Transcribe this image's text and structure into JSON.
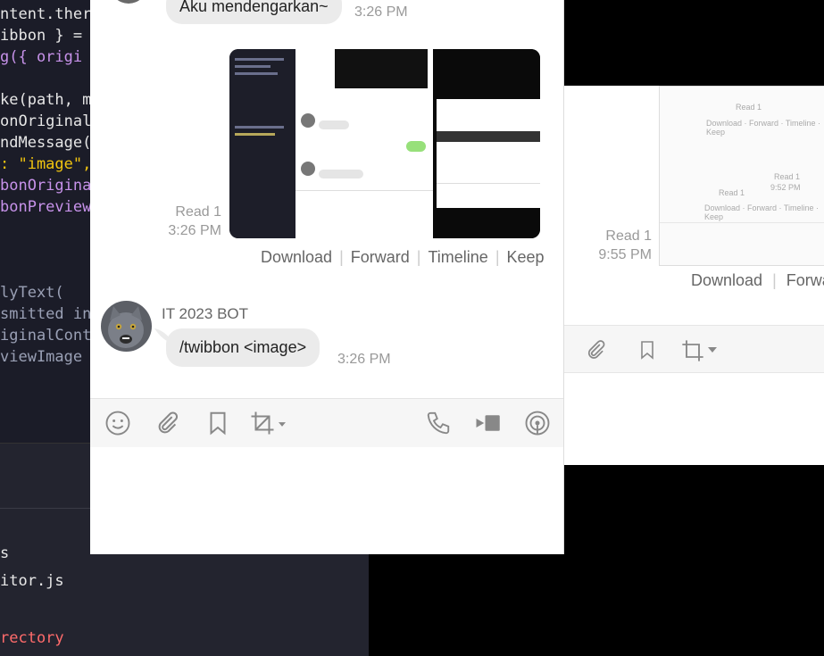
{
  "editor": {
    "code_lines": [
      {
        "text": "ntent.ther",
        "color": "#e6e6e6"
      },
      {
        "text": "ibbon } =",
        "color": "#e6e6e6"
      },
      {
        "text": "g({ origi",
        "color": "#c792ea"
      },
      {
        "text": "",
        "color": "#e6e6e6"
      },
      {
        "text": "ke(path, m",
        "color": "#e6e6e6"
      },
      {
        "text": "onOriginal",
        "color": "#e6e6e6"
      },
      {
        "text": "ndMessage(",
        "color": "#e6e6e6"
      },
      {
        "text": ": \"image\",",
        "color": "#f1c40f"
      },
      {
        "text": "bonOrigina",
        "color": "#c792ea"
      },
      {
        "text": "bonPreview",
        "color": "#c792ea"
      },
      {
        "text": "",
        "color": "#e6e6e6"
      },
      {
        "text": "",
        "color": "#e6e6e6"
      },
      {
        "text": "",
        "color": "#e6e6e6"
      },
      {
        "text": "lyText(",
        "color": "#9aa0b5"
      },
      {
        "text": "smitted in",
        "color": "#9aa0b5"
      },
      {
        "text": "iginalConte",
        "color": "#9aa0b5"
      },
      {
        "text": "viewImage",
        "color": "#9aa0b5"
      }
    ],
    "panel_lines": [
      "s",
      "itor.js",
      "",
      "rectory"
    ]
  },
  "chat": {
    "messages": [
      {
        "text": "Aku mendengarkan~",
        "time": "3:26 PM"
      },
      {
        "read": "Read 1",
        "time": "3:26 PM"
      },
      {
        "sender": "IT 2023 BOT",
        "text": "/twibbon <image>",
        "time": "3:26 PM"
      }
    ],
    "actions": [
      "Download",
      "Forward",
      "Timeline",
      "Keep"
    ]
  },
  "back_window": {
    "read": "Read 1",
    "time": "9:55 PM",
    "actions": [
      "Download",
      "Forwa"
    ]
  },
  "colors": {
    "bubble": "#ebebeb",
    "muted_text": "#999999",
    "toolbar_bg": "#f6f6f6"
  }
}
